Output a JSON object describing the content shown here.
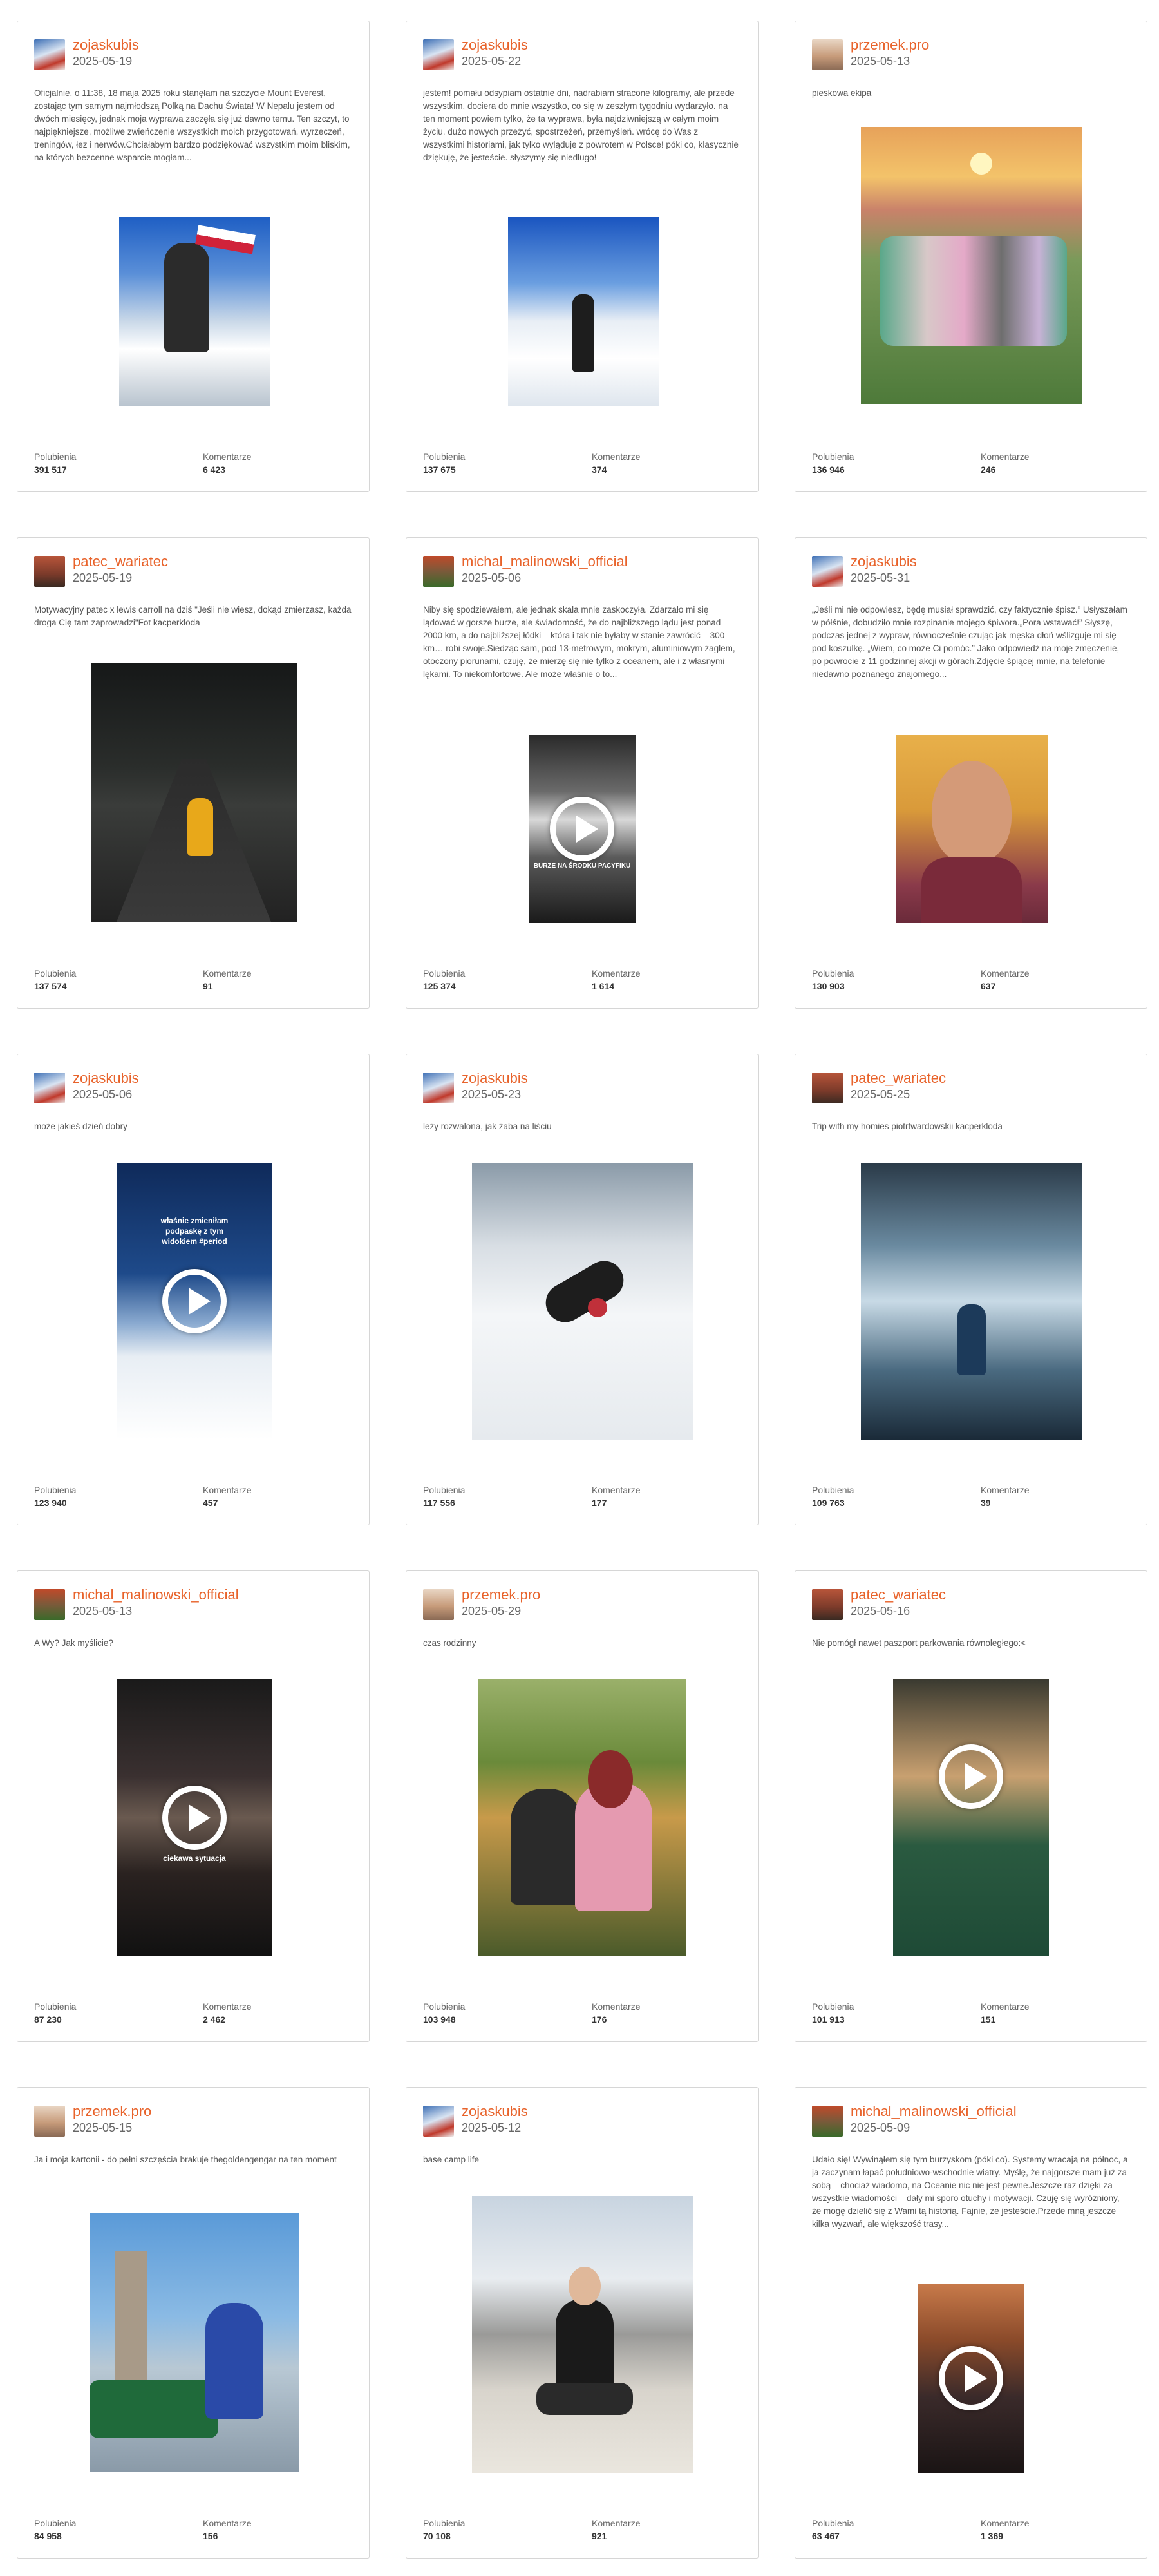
{
  "labels": {
    "likes": "Polubienia",
    "comments": "Komentarze"
  },
  "posts": [
    {
      "user": "zojaskubis",
      "date": "2025-05-19",
      "caption": "Oficjalnie, o 11:38, 18 maja 2025 roku stanęłam na szczycie Mount Everest, zostając tym samym najmłodszą Polką na Dachu Świata! W Nepalu jestem od dwóch miesięcy, jednak moja wyprawa zaczęła się już dawno temu. Ten szczyt, to najpiękniejsze, możliwe zwieńczenie wszystkich moich przygotowań, wyrzeczeń, treningów, łez i nerwów.Chciałabym bardzo podziękować wszystkim moim bliskim, na których bezcenne wsparcie mogłam...",
      "likes": "391 517",
      "comments": "6 423",
      "video": false,
      "overlay": ""
    },
    {
      "user": "zojaskubis",
      "date": "2025-05-22",
      "caption": "jestem! pomału odsypiam ostatnie dni, nadrabiam stracone kilogramy, ale przede wszystkim, dociera do mnie wszystko, co się w zeszłym tygodniu wydarzyło. na ten moment powiem tylko, że ta wyprawa, była najdziwniejszą w całym moim życiu. dużo nowych przeżyć, spostrzeżeń, przemyśleń. wrócę do Was z wszystkimi historiami, jak tylko wyląduję z powrotem w Polsce! póki co, klasycznie dziękuję, że jesteście. słyszymy się niedługo!",
      "likes": "137 675",
      "comments": "374",
      "video": false,
      "overlay": ""
    },
    {
      "user": "przemek.pro",
      "date": "2025-05-13",
      "caption": "pieskowa ekipa",
      "likes": "136 946",
      "comments": "246",
      "video": false,
      "overlay": ""
    },
    {
      "user": "patec_wariatec",
      "date": "2025-05-19",
      "caption": "Motywacyjny patec x lewis carroll na dziś \"Jeśli nie wiesz, dokąd zmierzasz, każda droga Cię tam zaprowadzi\"Fot kacperkloda_",
      "likes": "137 574",
      "comments": "91",
      "video": false,
      "overlay": ""
    },
    {
      "user": "michal_malinowski_official",
      "date": "2025-05-06",
      "caption": "Niby się spodziewałem, ale jednak skala mnie zaskoczyła. Zdarzało mi się lądować w gorsze burze, ale świadomość, że do najbliższego lądu jest ponad 2000 km, a do najbliższej łódki – która i tak nie byłaby w stanie zawrócić – 300 km… robi swoje.Siedząc sam, pod 13-metrowym, mokrym, aluminiowym żaglem, otoczony piorunami, czuję, że mierzę się nie tylko z oceanem, ale i z własnymi lękami. To niekomfortowe. Ale może właśnie o to...",
      "likes": "125 374",
      "comments": "1 614",
      "video": true,
      "overlay": "BURZE NA ŚRODKU PACYFIKU"
    },
    {
      "user": "zojaskubis",
      "date": "2025-05-31",
      "caption": "„Jeśli mi nie odpowiesz, będę musiał sprawdzić, czy faktycznie śpisz.” Usłyszałam w półśnie, dobudziło mnie rozpinanie mojego śpiwora.„Pora wstawać!” Słyszę, podczas jednej z wypraw, równocześnie czując jak męska dłoń wślizguje mi się pod koszulkę. „Wiem, co może Ci pomóc.” Jako odpowiedź na moje zmęczenie, po powrocie z 11 godzinnej akcji w górach.Zdjęcie śpiącej mnie, na telefonie niedawno poznanego znajomego...",
      "likes": "130 903",
      "comments": "637",
      "video": false,
      "overlay": ""
    },
    {
      "user": "zojaskubis",
      "date": "2025-05-06",
      "caption": "może jakieś dzień dobry",
      "likes": "123 940",
      "comments": "457",
      "video": true,
      "overlay": "właśnie zmieniłam podpaskę z tym widokiem #period"
    },
    {
      "user": "zojaskubis",
      "date": "2025-05-23",
      "caption": "leży rozwalona, jak żaba na liściu",
      "likes": "117 556",
      "comments": "177",
      "video": false,
      "overlay": ""
    },
    {
      "user": "patec_wariatec",
      "date": "2025-05-25",
      "caption": "Trip with my homies piotrtwardowskii kacperkloda_",
      "likes": "109 763",
      "comments": "39",
      "video": false,
      "overlay": ""
    },
    {
      "user": "michal_malinowski_official",
      "date": "2025-05-13",
      "caption": "A Wy? Jak myślicie?",
      "likes": "87 230",
      "comments": "2 462",
      "video": true,
      "overlay": "ciekawa sytuacja"
    },
    {
      "user": "przemek.pro",
      "date": "2025-05-29",
      "caption": "czas rodzinny",
      "likes": "103 948",
      "comments": "176",
      "video": false,
      "overlay": ""
    },
    {
      "user": "patec_wariatec",
      "date": "2025-05-16",
      "caption": "Nie pomógł nawet paszport parkowania równoległego:<",
      "likes": "101 913",
      "comments": "151",
      "video": true,
      "overlay": ""
    },
    {
      "user": "przemek.pro",
      "date": "2025-05-15",
      "caption": "Ja i moja kartonii - do pełni szczęścia brakuje thegoldengengar na ten moment",
      "likes": "84 958",
      "comments": "156",
      "video": false,
      "overlay": ""
    },
    {
      "user": "zojaskubis",
      "date": "2025-05-12",
      "caption": "base camp life",
      "likes": "70 108",
      "comments": "921",
      "video": false,
      "overlay": ""
    },
    {
      "user": "michal_malinowski_official",
      "date": "2025-05-09",
      "caption": "Udało się! Wywinąłem się tym burzyskom (póki co). Systemy wracają na północ, a ja zaczynam łapać południowo-wschodnie wiatry. Myślę, że najgorsze mam już za sobą – chociaż wiadomo, na Oceanie nic nie jest pewne.Jeszcze raz dzięki za wszystkie wiadomości – dały mi sporo otuchy i motywacji. Czuję się wyróżniony, że mogę dzielić się z Wami tą historią. Fajnie, że jesteście.Przede mną jeszcze kilka wyzwań, ale większość trasy...",
      "likes": "63 467",
      "comments": "1 369",
      "video": true,
      "overlay": ""
    }
  ]
}
